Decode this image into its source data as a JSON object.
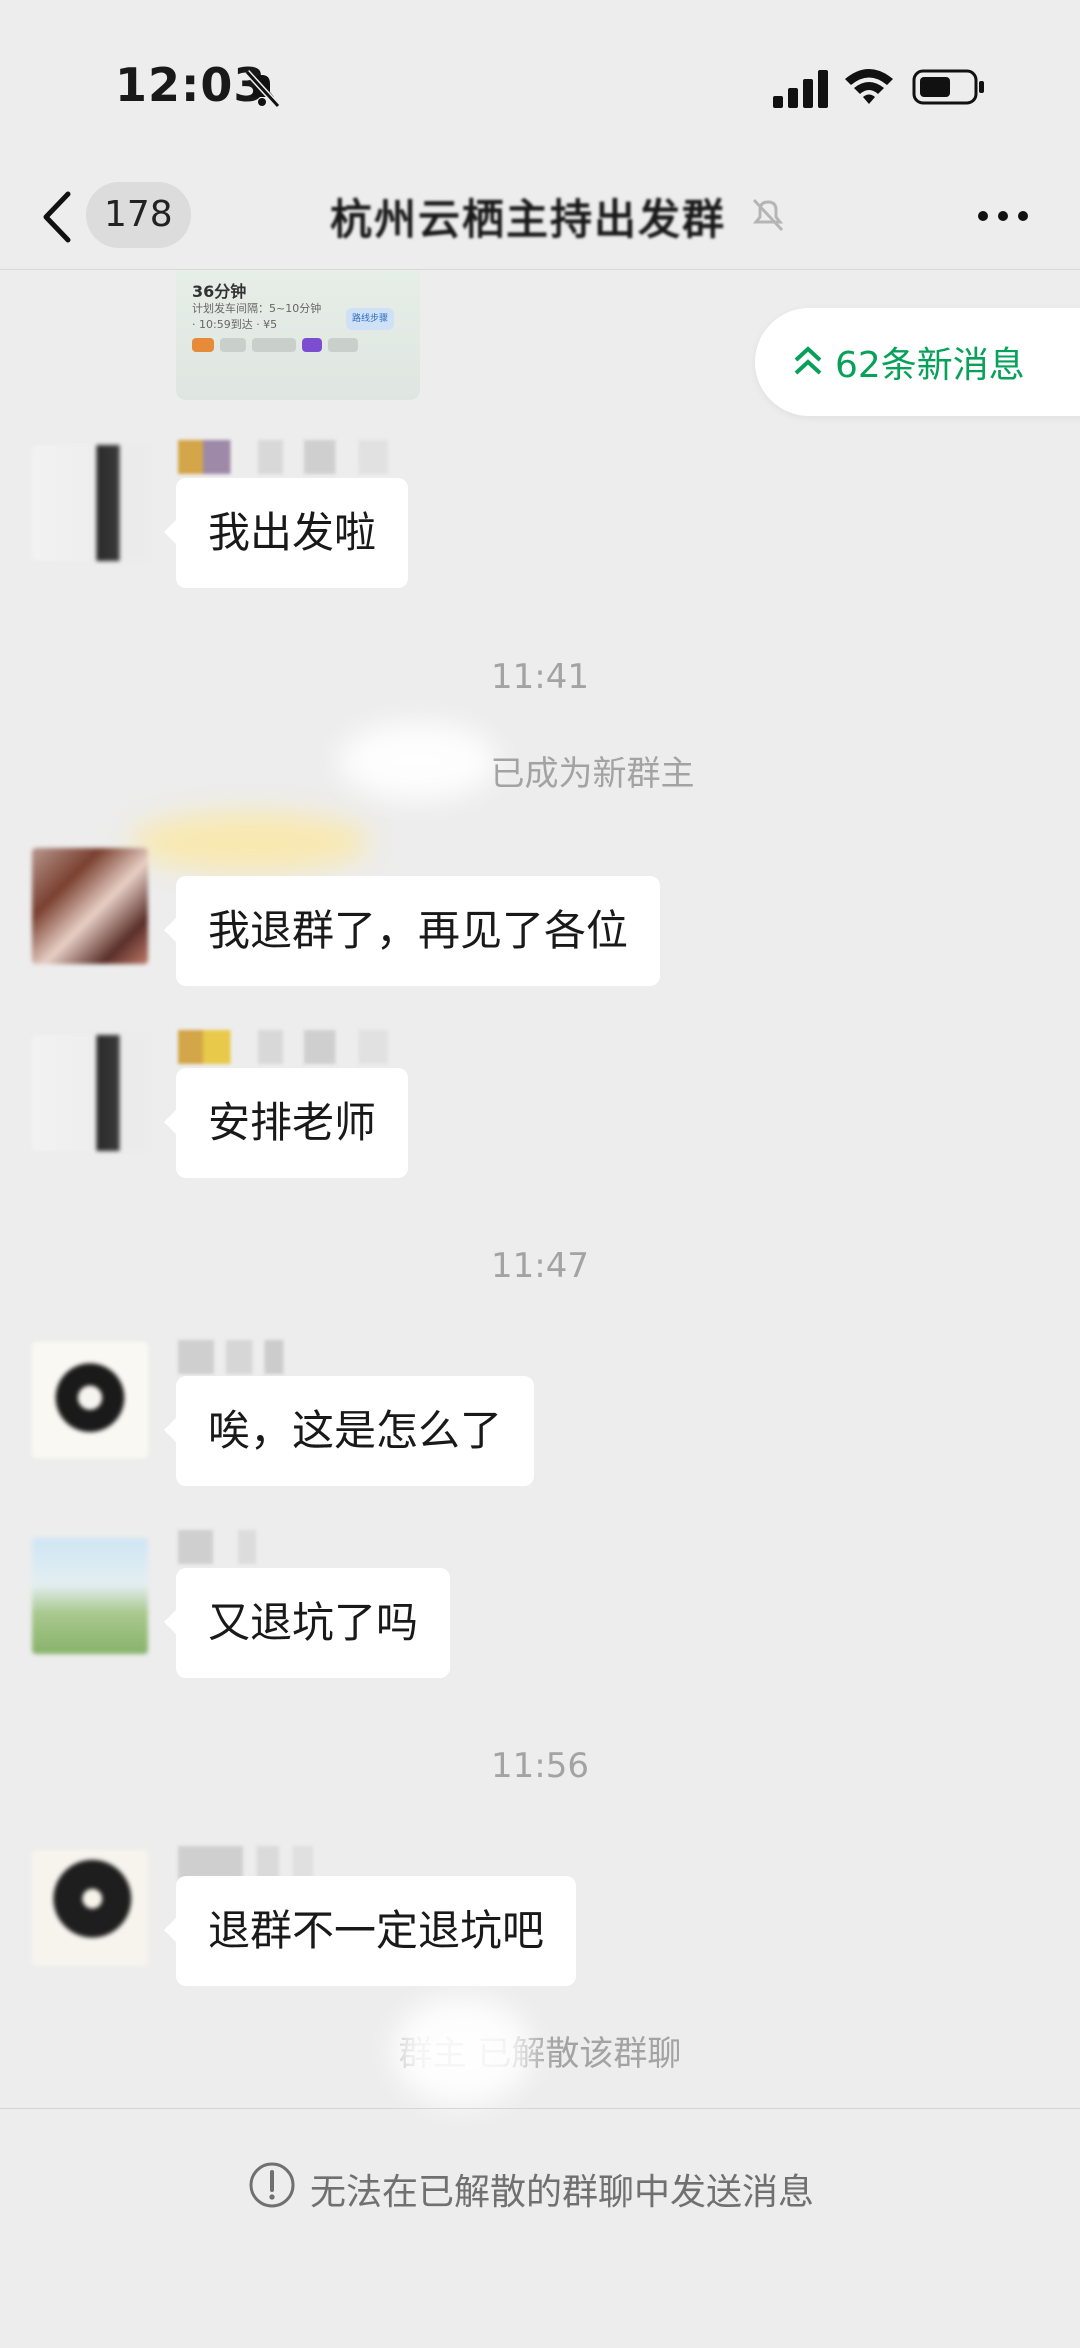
{
  "status_bar": {
    "time": "12:03"
  },
  "header": {
    "unread_count": "178",
    "title": "杭州云栖主持出发群"
  },
  "new_messages": {
    "label": "62条新消息"
  },
  "image_preview": {
    "title": "36分钟",
    "subtitle": "计划发车间隔：5~10分钟 · 10:59到达 · ¥5",
    "button": "路线步骤"
  },
  "messages": [
    {
      "type": "text",
      "text": "我出发啦"
    },
    {
      "type": "time",
      "text": "11:41"
    },
    {
      "type": "system",
      "text": "已成为新群主"
    },
    {
      "type": "text",
      "text": "我退群了，再见了各位"
    },
    {
      "type": "text",
      "text": "安排老师"
    },
    {
      "type": "time",
      "text": "11:47"
    },
    {
      "type": "text",
      "text": "唉，这是怎么了"
    },
    {
      "type": "text",
      "text": "又退坑了吗"
    },
    {
      "type": "time",
      "text": "11:56"
    },
    {
      "type": "text",
      "text": "退群不一定退坑吧"
    },
    {
      "type": "system",
      "text": "群主 已解散该群聊"
    }
  ],
  "footer": {
    "notice": "无法在已解散的群聊中发送消息"
  },
  "colors": {
    "background": "#ededed",
    "bubble": "#ffffff",
    "accent_green": "#07a15a"
  }
}
